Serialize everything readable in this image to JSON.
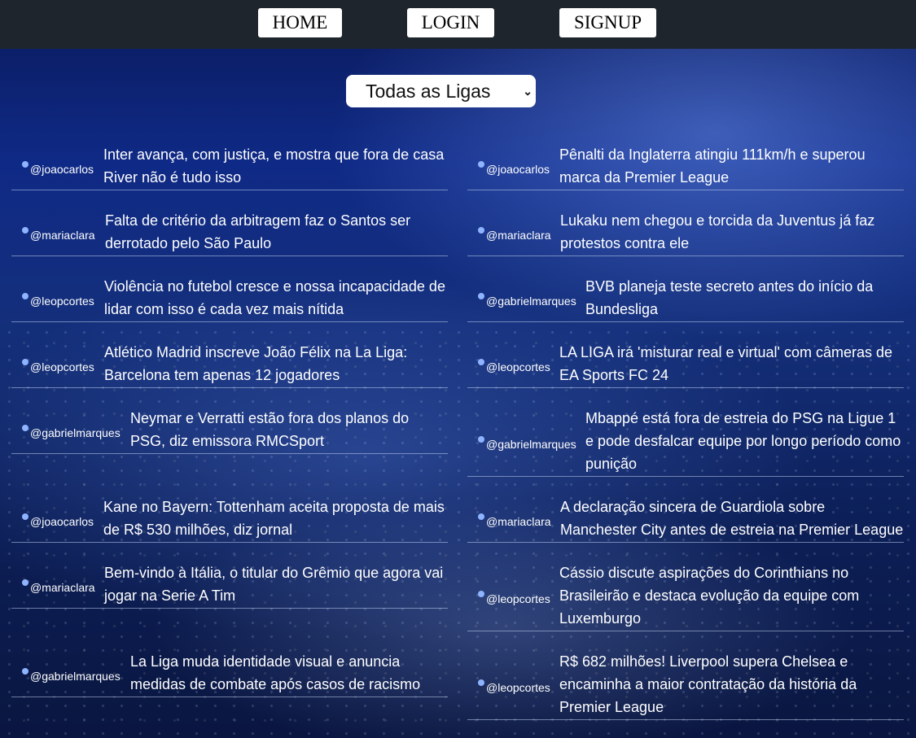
{
  "nav": {
    "home": "HOME",
    "login": "LOGIN",
    "signup": "SIGNUP"
  },
  "filter": {
    "selected": "Todas as Ligas"
  },
  "left_news": [
    {
      "author": "@joaocarlos",
      "title": "Inter avança, com justiça, e mostra que fora de casa River não é tudo isso"
    },
    {
      "author": "@mariaclara",
      "title": "Falta de critério da arbitragem faz o Santos ser derrotado pelo São Paulo"
    },
    {
      "author": "@leopcortes",
      "title": "Violência no futebol cresce e nossa incapacidade de lidar com isso é cada vez mais nítida"
    },
    {
      "author": "@leopcortes",
      "title": "Atlético Madrid inscreve João Félix na La Liga: Barcelona tem apenas 12 jogadores"
    },
    {
      "author": "@gabrielmarques",
      "title": "Neymar e Verratti estão fora dos planos do PSG, diz emissora RMCSport"
    },
    {
      "author": "@joaocarlos",
      "title": "Kane no Bayern: Tottenham aceita proposta de mais de R$ 530 milhões, diz jornal"
    },
    {
      "author": "@mariaclara",
      "title": "Bem-vindo à Itália, o titular do Grêmio que agora vai jogar na Serie A Tim"
    },
    {
      "author": "@gabrielmarques",
      "title": "La Liga muda identidade visual e anuncia medidas de combate após casos de racismo"
    }
  ],
  "right_news": [
    {
      "author": "@joaocarlos",
      "title": "Pênalti da Inglaterra atingiu 111km/h e superou marca da Premier League"
    },
    {
      "author": "@mariaclara",
      "title": "Lukaku nem chegou e torcida da Juventus já faz protestos contra ele"
    },
    {
      "author": "@gabrielmarques",
      "title": "BVB planeja teste secreto antes do início da Bundesliga"
    },
    {
      "author": "@leopcortes",
      "title": "LA LIGA irá 'misturar real e virtual' com câmeras de EA Sports FC 24"
    },
    {
      "author": "@gabrielmarques",
      "title": "Mbappé está fora de estreia do PSG na Ligue 1 e pode desfalcar equipe por longo período como punição"
    },
    {
      "author": "@mariaclara",
      "title": "A declaração sincera de Guardiola sobre Manchester City antes de estreia na Premier League"
    },
    {
      "author": "@leopcortes",
      "title": "Cássio discute aspirações do Corinthians no Brasileirão e destaca evolução da equipe com Luxemburgo"
    },
    {
      "author": "@leopcortes",
      "title": "R$ 682 milhões! Liverpool supera Chelsea e encaminha a maior contratação da história da Premier League"
    }
  ]
}
